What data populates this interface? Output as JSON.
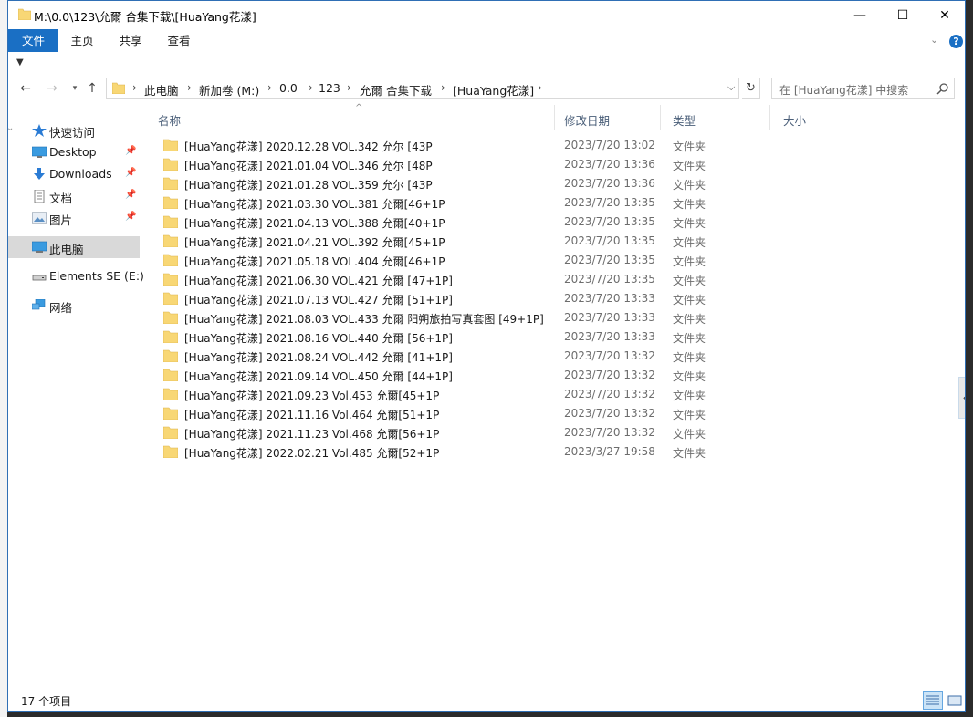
{
  "window": {
    "title": "M:\\0.0\\123\\允爾 合集下载\\[HuaYang花漾]",
    "minimize": "—",
    "maximize": "☐",
    "close": "✕"
  },
  "ribbon": {
    "tabs": [
      "文件",
      "主页",
      "共享",
      "查看"
    ],
    "help": "?",
    "collapse": "⌄"
  },
  "address": {
    "crumbs": [
      "此电脑",
      "新加卷 (M:)",
      "0.0",
      "123",
      "允爾 合集下载",
      "[HuaYang花漾]"
    ],
    "separator": "›"
  },
  "search": {
    "placeholder": "在 [HuaYang花漾] 中搜索"
  },
  "navpane": {
    "items": [
      {
        "label": "快速访问",
        "icon": "star-icon"
      },
      {
        "label": "Desktop",
        "icon": "desktop-icon"
      },
      {
        "label": "Downloads",
        "icon": "download-icon"
      },
      {
        "label": "文档",
        "icon": "document-icon"
      },
      {
        "label": "图片",
        "icon": "pictures-icon"
      },
      {
        "label": "此电脑",
        "icon": "computer-icon"
      },
      {
        "label": "Elements SE (E:)",
        "icon": "drive-icon"
      },
      {
        "label": "网络",
        "icon": "network-icon"
      }
    ]
  },
  "columns": {
    "name": "名称",
    "date": "修改日期",
    "type": "类型",
    "size": "大小"
  },
  "files": [
    {
      "name": "[HuaYang花漾] 2020.12.28 VOL.342 允尔 [43P",
      "date": "2023/7/20 13:02",
      "type": "文件夹"
    },
    {
      "name": "[HuaYang花漾] 2021.01.04 VOL.346 允尔 [48P",
      "date": "2023/7/20 13:36",
      "type": "文件夹"
    },
    {
      "name": "[HuaYang花漾] 2021.01.28 VOL.359 允尔 [43P",
      "date": "2023/7/20 13:36",
      "type": "文件夹"
    },
    {
      "name": "[HuaYang花漾] 2021.03.30 VOL.381 允爾[46+1P",
      "date": "2023/7/20 13:35",
      "type": "文件夹"
    },
    {
      "name": "[HuaYang花漾] 2021.04.13 VOL.388 允爾[40+1P",
      "date": "2023/7/20 13:35",
      "type": "文件夹"
    },
    {
      "name": "[HuaYang花漾] 2021.04.21 VOL.392 允爾[45+1P",
      "date": "2023/7/20 13:35",
      "type": "文件夹"
    },
    {
      "name": "[HuaYang花漾] 2021.05.18 VOL.404 允爾[46+1P",
      "date": "2023/7/20 13:35",
      "type": "文件夹"
    },
    {
      "name": "[HuaYang花漾] 2021.06.30 VOL.421 允爾 [47+1P]",
      "date": "2023/7/20 13:35",
      "type": "文件夹"
    },
    {
      "name": "[HuaYang花漾] 2021.07.13 VOL.427 允爾 [51+1P]",
      "date": "2023/7/20 13:33",
      "type": "文件夹"
    },
    {
      "name": "[HuaYang花漾] 2021.08.03 VOL.433 允爾 阳朔旅拍写真套图 [49+1P]",
      "date": "2023/7/20 13:33",
      "type": "文件夹"
    },
    {
      "name": "[HuaYang花漾] 2021.08.16 VOL.440 允爾 [56+1P]",
      "date": "2023/7/20 13:33",
      "type": "文件夹"
    },
    {
      "name": "[HuaYang花漾] 2021.08.24 VOL.442 允爾 [41+1P]",
      "date": "2023/7/20 13:32",
      "type": "文件夹"
    },
    {
      "name": "[HuaYang花漾] 2021.09.14 VOL.450 允爾 [44+1P]",
      "date": "2023/7/20 13:32",
      "type": "文件夹"
    },
    {
      "name": "[HuaYang花漾] 2021.09.23 Vol.453 允爾[45+1P",
      "date": "2023/7/20 13:32",
      "type": "文件夹"
    },
    {
      "name": "[HuaYang花漾] 2021.11.16 Vol.464 允爾[51+1P",
      "date": "2023/7/20 13:32",
      "type": "文件夹"
    },
    {
      "name": "[HuaYang花漾] 2021.11.23 Vol.468 允爾[56+1P",
      "date": "2023/7/20 13:32",
      "type": "文件夹"
    },
    {
      "name": "[HuaYang花漾] 2022.02.21 Vol.485 允爾[52+1P",
      "date": "2023/3/27 19:58",
      "type": "文件夹"
    }
  ],
  "status": {
    "count": "17 个项目"
  },
  "colors": {
    "accent": "#1a6fc4",
    "folder": "#f8d775",
    "selected_nav": "#d9d9d9"
  }
}
